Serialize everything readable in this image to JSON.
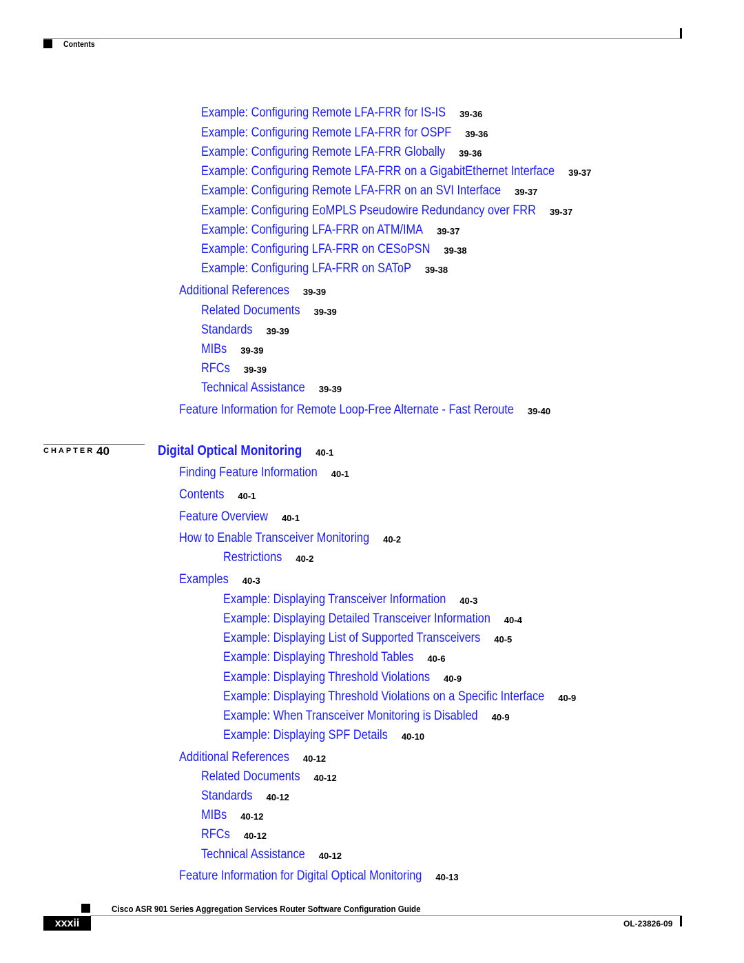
{
  "header": {
    "label": "Contents"
  },
  "toc_part1": [
    {
      "text": "Example: Configuring Remote LFA-FRR for IS-IS",
      "page": "39-36",
      "level": 2
    },
    {
      "text": "Example: Configuring Remote LFA-FRR for OSPF",
      "page": "39-36",
      "level": 2
    },
    {
      "text": "Example: Configuring Remote LFA-FRR Globally",
      "page": "39-36",
      "level": 2
    },
    {
      "text": "Example: Configuring Remote LFA-FRR on a GigabitEthernet Interface",
      "page": "39-37",
      "level": 2
    },
    {
      "text": "Example: Configuring Remote LFA-FRR on an SVI Interface",
      "page": "39-37",
      "level": 2
    },
    {
      "text": "Example: Configuring EoMPLS Pseudowire Redundancy over FRR",
      "page": "39-37",
      "level": 2
    },
    {
      "text": "Example: Configuring LFA-FRR on ATM/IMA",
      "page": "39-37",
      "level": 2
    },
    {
      "text": "Example: Configuring LFA-FRR on CESoPSN",
      "page": "39-38",
      "level": 2
    },
    {
      "text": "Example: Configuring LFA-FRR on SAToP",
      "page": "39-38",
      "level": 2
    },
    {
      "text": "Additional References",
      "page": "39-39",
      "level": 1
    },
    {
      "text": "Related Documents",
      "page": "39-39",
      "level": 2
    },
    {
      "text": "Standards",
      "page": "39-39",
      "level": 2
    },
    {
      "text": "MIBs",
      "page": "39-39",
      "level": 2
    },
    {
      "text": "RFCs",
      "page": "39-39",
      "level": 2
    },
    {
      "text": "Technical Assistance",
      "page": "39-39",
      "level": 2
    },
    {
      "text": "Feature Information for Remote Loop-Free Alternate - Fast Reroute",
      "page": "39-40",
      "level": 1
    }
  ],
  "chapter": {
    "label": "CHAPTER",
    "number": "40",
    "title": "Digital Optical Monitoring",
    "page": "40-1"
  },
  "toc_part2": [
    {
      "text": "Finding Feature Information",
      "page": "40-1",
      "level": 1
    },
    {
      "text": "Contents",
      "page": "40-1",
      "level": 1
    },
    {
      "text": "Feature Overview",
      "page": "40-1",
      "level": 1
    },
    {
      "text": "How to Enable Transceiver Monitoring",
      "page": "40-2",
      "level": 1
    },
    {
      "text": "Restrictions",
      "page": "40-2",
      "level": 3
    },
    {
      "text": "Examples",
      "page": "40-3",
      "level": 1
    },
    {
      "text": "Example: Displaying Transceiver Information",
      "page": "40-3",
      "level": 3
    },
    {
      "text": "Example: Displaying Detailed Transceiver Information",
      "page": "40-4",
      "level": 3
    },
    {
      "text": "Example: Displaying List of Supported Transceivers",
      "page": "40-5",
      "level": 3
    },
    {
      "text": "Example: Displaying Threshold Tables",
      "page": "40-6",
      "level": 3
    },
    {
      "text": "Example: Displaying Threshold Violations",
      "page": "40-9",
      "level": 3
    },
    {
      "text": "Example: Displaying Threshold Violations on a Specific Interface",
      "page": "40-9",
      "level": 3
    },
    {
      "text": "Example: When Transceiver Monitoring is Disabled",
      "page": "40-9",
      "level": 3
    },
    {
      "text": "Example: Displaying SPF Details",
      "page": "40-10",
      "level": 3
    },
    {
      "text": "Additional References",
      "page": "40-12",
      "level": 1
    },
    {
      "text": "Related Documents",
      "page": "40-12",
      "level": 2
    },
    {
      "text": "Standards",
      "page": "40-12",
      "level": 2
    },
    {
      "text": "MIBs",
      "page": "40-12",
      "level": 2
    },
    {
      "text": "RFCs",
      "page": "40-12",
      "level": 2
    },
    {
      "text": "Technical Assistance",
      "page": "40-12",
      "level": 2
    },
    {
      "text": "Feature Information for Digital Optical Monitoring",
      "page": "40-13",
      "level": 1
    }
  ],
  "footer": {
    "title": "Cisco ASR 901 Series Aggregation Services Router Software Configuration Guide",
    "page_number": "xxxii",
    "doc_id": "OL-23826-09"
  }
}
